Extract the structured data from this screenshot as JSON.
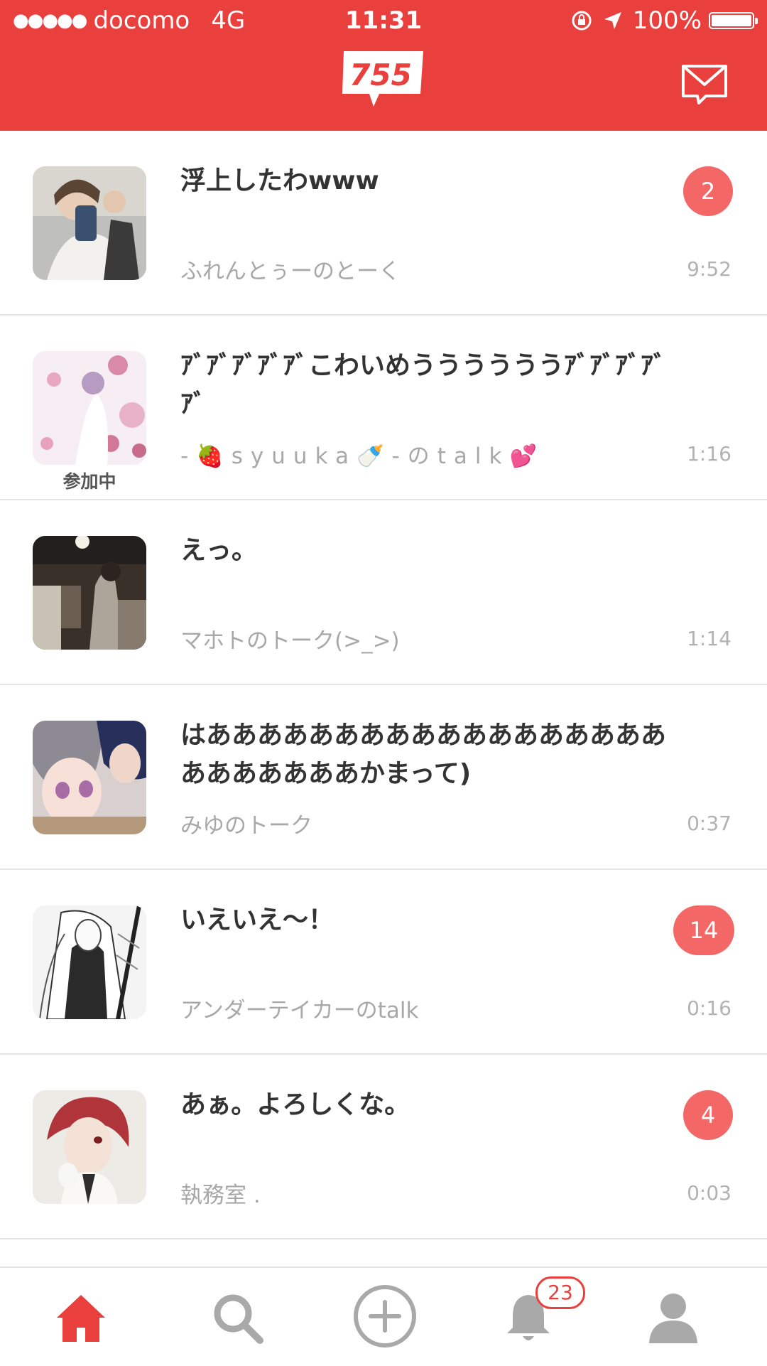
{
  "status_bar": {
    "carrier": "docomo",
    "network": "4G",
    "time": "11:31",
    "battery": "100%"
  },
  "header": {
    "logo_text": "755",
    "mail_icon": "envelope-icon",
    "brand_color": "#e9403d"
  },
  "talks": [
    {
      "title": "浮上したわwww",
      "room": "ふれんとぅーのとーく",
      "time": "9:52",
      "badge": "2",
      "avatar": "selfie-photo"
    },
    {
      "title": "ｱﾞｱﾞｱﾞｱﾞｱﾞこわいめううううううｱﾞｱﾞｱﾞｱﾞｱﾞ",
      "room": "-🍓syuuka🍼-のtalk💕",
      "time": "1:16",
      "joined_label": "参加中",
      "avatar": "pink-illustration"
    },
    {
      "title": "えっ。",
      "room": "マホトのトーク(>_>)",
      "time": "1:14",
      "avatar": "studio-photo"
    },
    {
      "title": "はあああああああああああああああああああああああああかまって)",
      "room": "みゆのトーク",
      "time": "0:37",
      "avatar": "anime-couple"
    },
    {
      "title": "いえいえ〜！",
      "room": "アンダーテイカーのtalk",
      "time": "0:16",
      "badge": "14",
      "avatar": "sketch-character"
    },
    {
      "title": "あぁ。よろしくな。",
      "room": "執務室 .",
      "time": "0:03",
      "badge": "4",
      "avatar": "red-hair-character"
    }
  ],
  "tab_bar": {
    "tabs": [
      "home-icon",
      "search-icon",
      "plus-circle-icon",
      "bell-icon",
      "person-icon"
    ],
    "notification_count": "23",
    "active_color": "#e9403d",
    "inactive_color": "#a9a9a9"
  }
}
